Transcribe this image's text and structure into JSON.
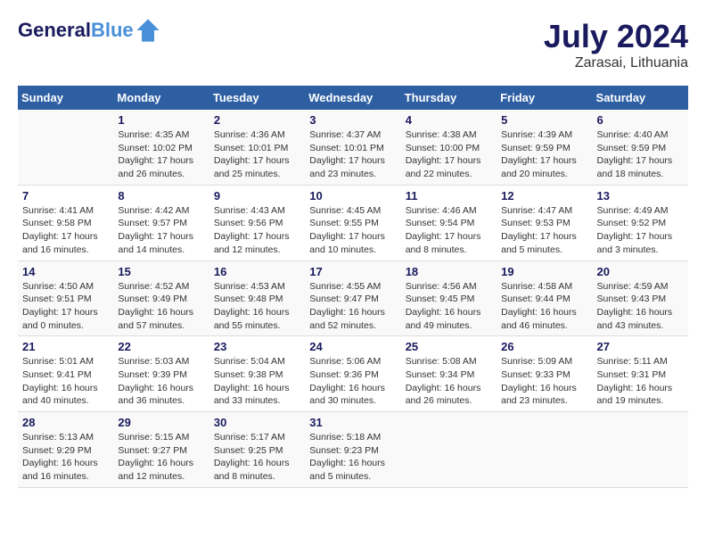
{
  "header": {
    "logo_line1": "General",
    "logo_line2": "Blue",
    "month_year": "July 2024",
    "location": "Zarasai, Lithuania"
  },
  "days_of_week": [
    "Sunday",
    "Monday",
    "Tuesday",
    "Wednesday",
    "Thursday",
    "Friday",
    "Saturday"
  ],
  "weeks": [
    [
      {
        "day": "",
        "info": ""
      },
      {
        "day": "1",
        "info": "Sunrise: 4:35 AM\nSunset: 10:02 PM\nDaylight: 17 hours\nand 26 minutes."
      },
      {
        "day": "2",
        "info": "Sunrise: 4:36 AM\nSunset: 10:01 PM\nDaylight: 17 hours\nand 25 minutes."
      },
      {
        "day": "3",
        "info": "Sunrise: 4:37 AM\nSunset: 10:01 PM\nDaylight: 17 hours\nand 23 minutes."
      },
      {
        "day": "4",
        "info": "Sunrise: 4:38 AM\nSunset: 10:00 PM\nDaylight: 17 hours\nand 22 minutes."
      },
      {
        "day": "5",
        "info": "Sunrise: 4:39 AM\nSunset: 9:59 PM\nDaylight: 17 hours\nand 20 minutes."
      },
      {
        "day": "6",
        "info": "Sunrise: 4:40 AM\nSunset: 9:59 PM\nDaylight: 17 hours\nand 18 minutes."
      }
    ],
    [
      {
        "day": "7",
        "info": "Sunrise: 4:41 AM\nSunset: 9:58 PM\nDaylight: 17 hours\nand 16 minutes."
      },
      {
        "day": "8",
        "info": "Sunrise: 4:42 AM\nSunset: 9:57 PM\nDaylight: 17 hours\nand 14 minutes."
      },
      {
        "day": "9",
        "info": "Sunrise: 4:43 AM\nSunset: 9:56 PM\nDaylight: 17 hours\nand 12 minutes."
      },
      {
        "day": "10",
        "info": "Sunrise: 4:45 AM\nSunset: 9:55 PM\nDaylight: 17 hours\nand 10 minutes."
      },
      {
        "day": "11",
        "info": "Sunrise: 4:46 AM\nSunset: 9:54 PM\nDaylight: 17 hours\nand 8 minutes."
      },
      {
        "day": "12",
        "info": "Sunrise: 4:47 AM\nSunset: 9:53 PM\nDaylight: 17 hours\nand 5 minutes."
      },
      {
        "day": "13",
        "info": "Sunrise: 4:49 AM\nSunset: 9:52 PM\nDaylight: 17 hours\nand 3 minutes."
      }
    ],
    [
      {
        "day": "14",
        "info": "Sunrise: 4:50 AM\nSunset: 9:51 PM\nDaylight: 17 hours\nand 0 minutes."
      },
      {
        "day": "15",
        "info": "Sunrise: 4:52 AM\nSunset: 9:49 PM\nDaylight: 16 hours\nand 57 minutes."
      },
      {
        "day": "16",
        "info": "Sunrise: 4:53 AM\nSunset: 9:48 PM\nDaylight: 16 hours\nand 55 minutes."
      },
      {
        "day": "17",
        "info": "Sunrise: 4:55 AM\nSunset: 9:47 PM\nDaylight: 16 hours\nand 52 minutes."
      },
      {
        "day": "18",
        "info": "Sunrise: 4:56 AM\nSunset: 9:45 PM\nDaylight: 16 hours\nand 49 minutes."
      },
      {
        "day": "19",
        "info": "Sunrise: 4:58 AM\nSunset: 9:44 PM\nDaylight: 16 hours\nand 46 minutes."
      },
      {
        "day": "20",
        "info": "Sunrise: 4:59 AM\nSunset: 9:43 PM\nDaylight: 16 hours\nand 43 minutes."
      }
    ],
    [
      {
        "day": "21",
        "info": "Sunrise: 5:01 AM\nSunset: 9:41 PM\nDaylight: 16 hours\nand 40 minutes."
      },
      {
        "day": "22",
        "info": "Sunrise: 5:03 AM\nSunset: 9:39 PM\nDaylight: 16 hours\nand 36 minutes."
      },
      {
        "day": "23",
        "info": "Sunrise: 5:04 AM\nSunset: 9:38 PM\nDaylight: 16 hours\nand 33 minutes."
      },
      {
        "day": "24",
        "info": "Sunrise: 5:06 AM\nSunset: 9:36 PM\nDaylight: 16 hours\nand 30 minutes."
      },
      {
        "day": "25",
        "info": "Sunrise: 5:08 AM\nSunset: 9:34 PM\nDaylight: 16 hours\nand 26 minutes."
      },
      {
        "day": "26",
        "info": "Sunrise: 5:09 AM\nSunset: 9:33 PM\nDaylight: 16 hours\nand 23 minutes."
      },
      {
        "day": "27",
        "info": "Sunrise: 5:11 AM\nSunset: 9:31 PM\nDaylight: 16 hours\nand 19 minutes."
      }
    ],
    [
      {
        "day": "28",
        "info": "Sunrise: 5:13 AM\nSunset: 9:29 PM\nDaylight: 16 hours\nand 16 minutes."
      },
      {
        "day": "29",
        "info": "Sunrise: 5:15 AM\nSunset: 9:27 PM\nDaylight: 16 hours\nand 12 minutes."
      },
      {
        "day": "30",
        "info": "Sunrise: 5:17 AM\nSunset: 9:25 PM\nDaylight: 16 hours\nand 8 minutes."
      },
      {
        "day": "31",
        "info": "Sunrise: 5:18 AM\nSunset: 9:23 PM\nDaylight: 16 hours\nand 5 minutes."
      },
      {
        "day": "",
        "info": ""
      },
      {
        "day": "",
        "info": ""
      },
      {
        "day": "",
        "info": ""
      }
    ]
  ]
}
